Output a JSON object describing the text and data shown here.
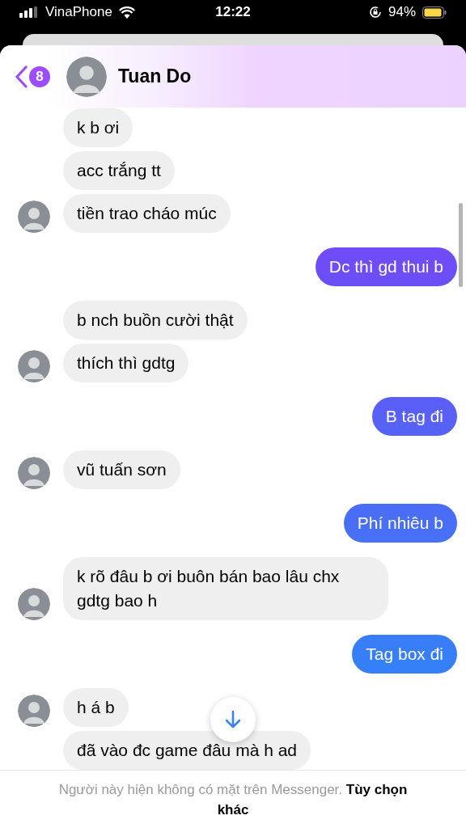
{
  "status_bar": {
    "carrier": "VinaPhone",
    "time": "12:22",
    "battery": "94%"
  },
  "header": {
    "back_badge": "8",
    "contact_name": "Tuan Do"
  },
  "messages": [
    {
      "kind": "incoming",
      "text": "k b ơi",
      "avatar": false
    },
    {
      "kind": "incoming",
      "text": "acc trắng tt",
      "avatar": false
    },
    {
      "kind": "incoming",
      "text": "tiền trao cháo múc",
      "avatar": true
    },
    {
      "kind": "outgoing",
      "text": "Dc thì gd thui b"
    },
    {
      "kind": "incoming",
      "text": "b nch buồn cười thật",
      "avatar": false
    },
    {
      "kind": "incoming",
      "text": "thích thì gdtg",
      "avatar": true
    },
    {
      "kind": "outgoing",
      "text": "B tag đi"
    },
    {
      "kind": "incoming",
      "text": "vũ tuấn sơn",
      "avatar": true
    },
    {
      "kind": "outgoing",
      "text": "Phí nhiêu b"
    },
    {
      "kind": "incoming",
      "text": "k rõ đâu b ơi buôn bán bao lâu chx gdtg bao h",
      "avatar": true
    },
    {
      "kind": "outgoing",
      "text": "Tag box đi"
    },
    {
      "kind": "incoming",
      "text": "h á b",
      "avatar": true
    },
    {
      "kind": "incoming",
      "text": "đã vào đc game đâu mà h ad",
      "avatar": false
    }
  ],
  "footer": {
    "notice": "Người này hiện không có mặt trên Messenger. **Tùy chọn khác**"
  }
}
